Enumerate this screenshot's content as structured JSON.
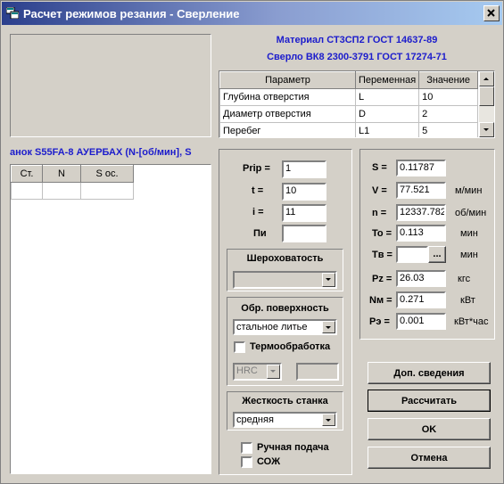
{
  "window": {
    "title": "Расчет режимов резания - Сверление"
  },
  "header": {
    "material": "Материал СТ3СП2 ГОСТ 14637-89",
    "tool": "Сверло ВК8 2300-3791 ГОСТ 17274-71"
  },
  "params_table": {
    "columns": [
      "Параметр",
      "Переменная",
      "Значение"
    ],
    "rows": [
      [
        "Глубина отверстия",
        "L",
        "10"
      ],
      [
        "Диаметр отверстия",
        "D",
        "2"
      ],
      [
        "Перебег",
        "L1",
        "5"
      ]
    ]
  },
  "machine_label": "анок S55FA-8 АУЕРБАХ (N-[об/мин], S",
  "speed_table": {
    "columns": [
      "Ст.",
      "N",
      "S ос."
    ]
  },
  "inputs": {
    "prip_label": "Prip =",
    "prip_value": "1",
    "t_label": "t =",
    "t_value": "10",
    "i_label": "i =",
    "i_value": "11",
    "pi_label": "Пи",
    "pi_value": ""
  },
  "roughness": {
    "title": "Шероховатость",
    "value": ""
  },
  "surface": {
    "title": "Обр. поверхность",
    "value": "стальное литье",
    "heat_treatment_label": "Термообработка",
    "heat_treatment_checked": false,
    "hardness_unit": "HRC",
    "hardness_value": ""
  },
  "rigidity": {
    "title": "Жесткость станка",
    "value": "средняя"
  },
  "options": {
    "manual_feed_label": "Ручная подача",
    "manual_feed_checked": false,
    "coolant_label": "СОЖ",
    "coolant_checked": false
  },
  "results": {
    "S": {
      "label": "S =",
      "value": "0.11787",
      "unit": ""
    },
    "V": {
      "label": "V =",
      "value": "77.521",
      "unit": "м/мин"
    },
    "n": {
      "label": "n =",
      "value": "12337.782",
      "unit": "об/мин"
    },
    "To": {
      "label": "To =",
      "value": "0.113",
      "unit": "мин"
    },
    "Tv": {
      "label": "Tв =",
      "value": "",
      "button": "...",
      "unit": "мин"
    },
    "Pz": {
      "label": "Pz =",
      "value": "26.03",
      "unit": "кгс"
    },
    "Nm": {
      "label": "Nм =",
      "value": "0.271",
      "unit": "кВт"
    },
    "Pe": {
      "label": "Pэ =",
      "value": "0.001",
      "unit": "кВт*час"
    }
  },
  "buttons": {
    "extra_info": "Доп. сведения",
    "calculate": "Рассчитать",
    "ok": "OK",
    "cancel": "Отмена"
  }
}
